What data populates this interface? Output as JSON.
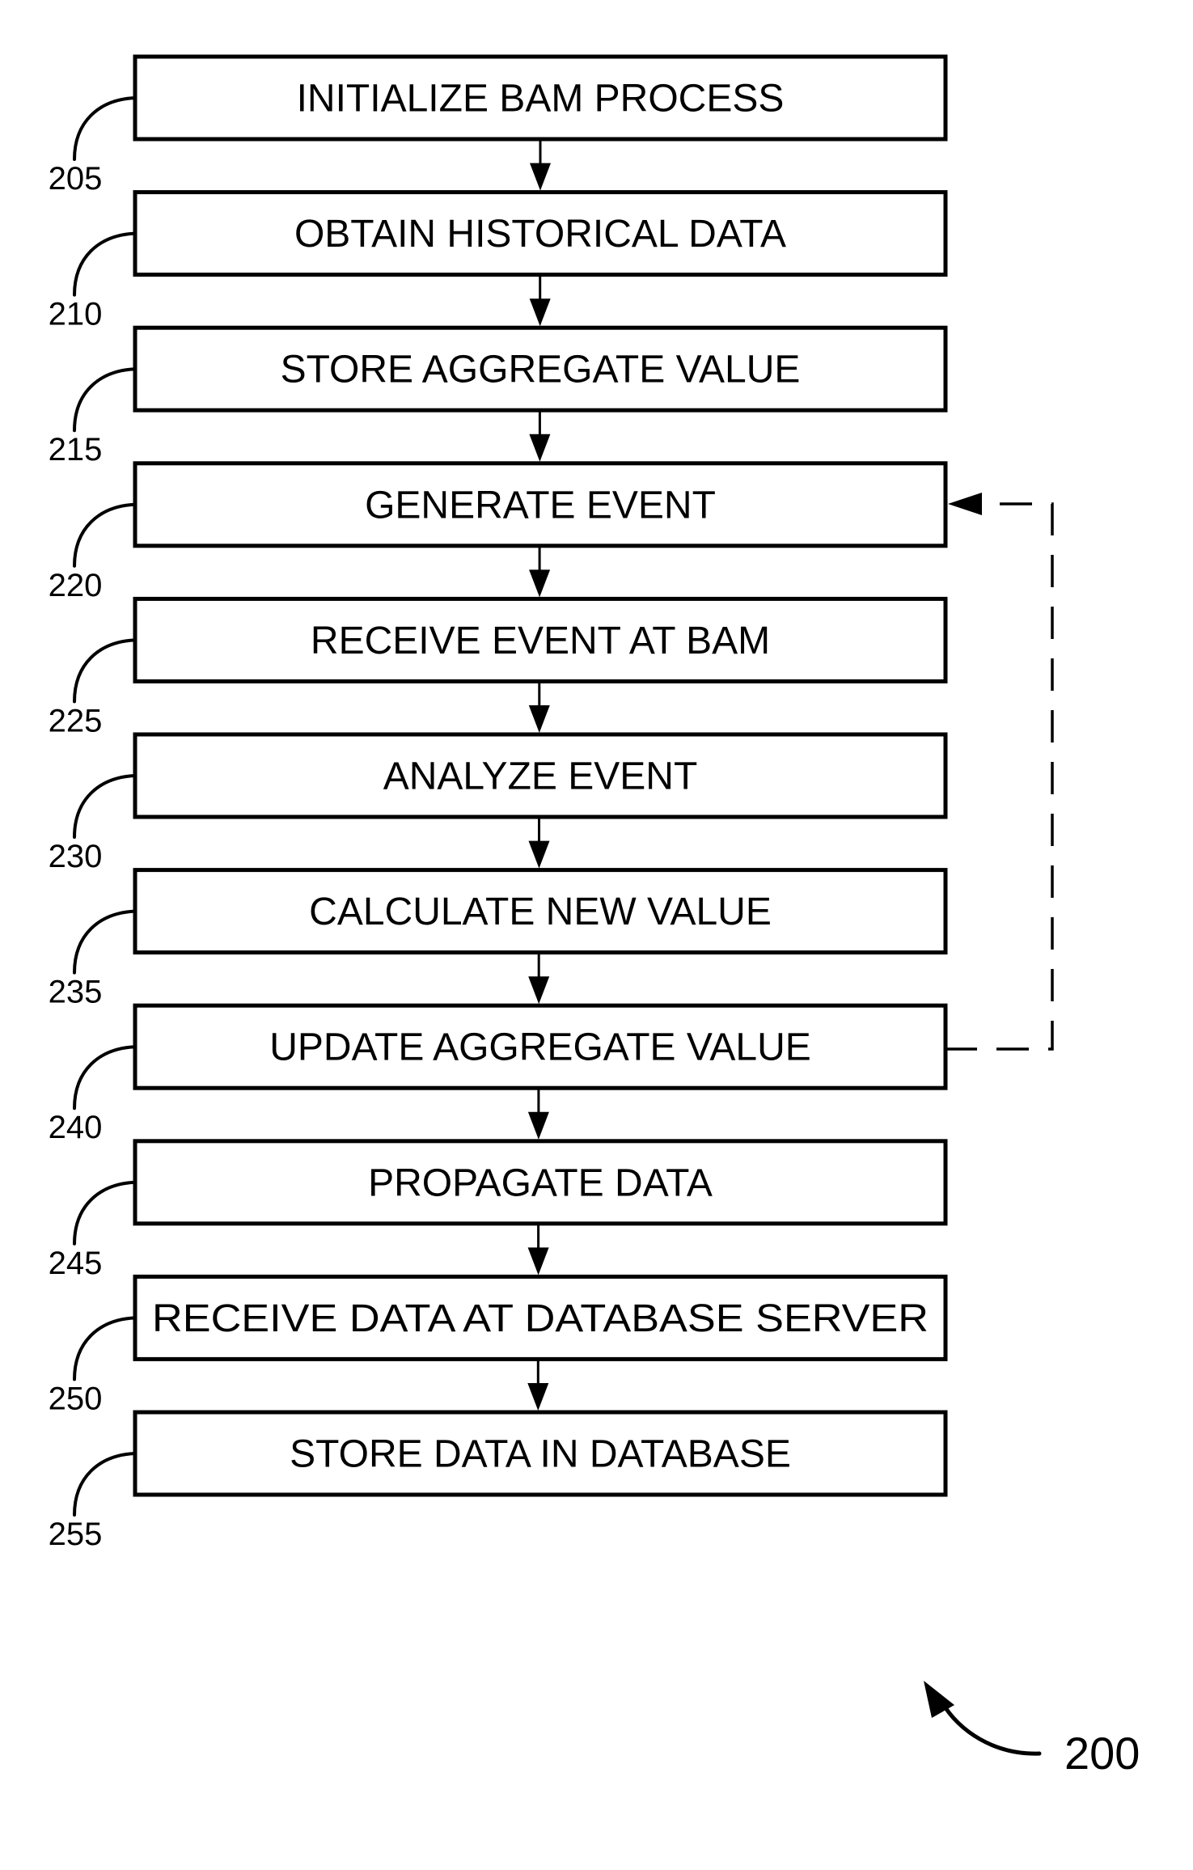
{
  "figure": {
    "reference": "200",
    "colors": {
      "stroke": "#000000",
      "background": "#ffffff"
    }
  },
  "steps": [
    {
      "ref": "205",
      "label": "INITIALIZE BAM PROCESS"
    },
    {
      "ref": "210",
      "label": "OBTAIN HISTORICAL DATA"
    },
    {
      "ref": "215",
      "label": "STORE AGGREGATE VALUE"
    },
    {
      "ref": "220",
      "label": "GENERATE EVENT"
    },
    {
      "ref": "225",
      "label": "RECEIVE EVENT AT BAM"
    },
    {
      "ref": "230",
      "label": "ANALYZE EVENT"
    },
    {
      "ref": "235",
      "label": "CALCULATE NEW VALUE"
    },
    {
      "ref": "240",
      "label": "UPDATE AGGREGATE VALUE"
    },
    {
      "ref": "245",
      "label": "PROPAGATE DATA"
    },
    {
      "ref": "250",
      "label": "RECEIVE DATA AT DATABASE SERVER"
    },
    {
      "ref": "255",
      "label": "STORE DATA IN DATABASE"
    }
  ],
  "flow": {
    "sequential": true,
    "feedback_loop": {
      "from_ref": "240",
      "to_ref": "220",
      "style": "dashed"
    }
  }
}
